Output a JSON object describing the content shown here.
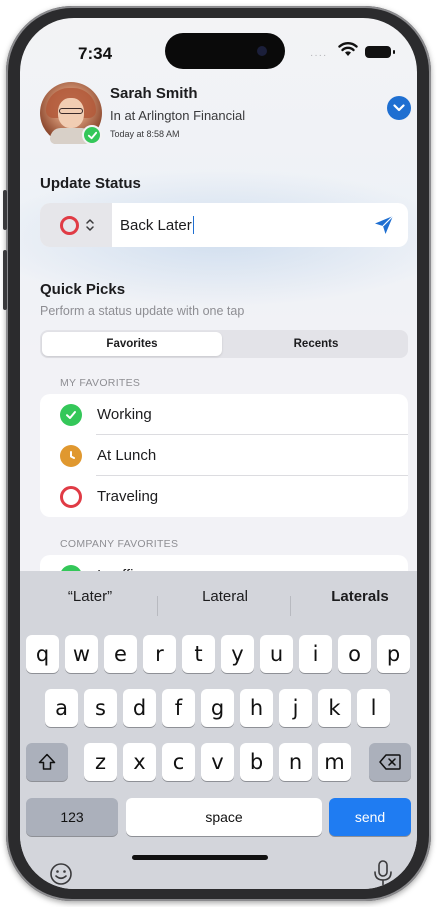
{
  "status_bar": {
    "time": "7:34",
    "signal_dots": "····"
  },
  "user": {
    "name": "Sarah Smith",
    "status": "In at Arlington Financial",
    "updated": "Today at 8:58 AM"
  },
  "update_status": {
    "title": "Update Status",
    "input_value": "Back Later"
  },
  "quick_picks": {
    "title": "Quick Picks",
    "subtitle": "Perform a status update with one tap",
    "tabs": [
      "Favorites",
      "Recents"
    ],
    "selected_tab": "Favorites",
    "my_favorites_header": "MY FAVORITES",
    "my_favorites": [
      {
        "label": "Working",
        "icon": "checkmark-icon",
        "color": "#34c759"
      },
      {
        "label": "At Lunch",
        "icon": "clock-icon",
        "color": "#e0982f"
      },
      {
        "label": "Traveling",
        "icon": "ring-icon",
        "color": "#e03b45"
      }
    ],
    "company_favorites_header": "COMPANY FAVORITES",
    "company_favorites": [
      {
        "label": "In office",
        "icon": "checkmark-icon",
        "color": "#34c759"
      }
    ]
  },
  "keyboard": {
    "suggestions": [
      "“Later”",
      "Lateral",
      "Laterals"
    ],
    "row1": [
      "q",
      "w",
      "e",
      "r",
      "t",
      "y",
      "u",
      "i",
      "o",
      "p"
    ],
    "row2": [
      "a",
      "s",
      "d",
      "f",
      "g",
      "h",
      "j",
      "k",
      "l"
    ],
    "row3": [
      "z",
      "x",
      "c",
      "v",
      "b",
      "n",
      "m"
    ],
    "numbers_label": "123",
    "space_label": "space",
    "send_label": "send"
  },
  "colors": {
    "accent": "#1f6fd1",
    "send_key": "#1f7cf2",
    "available": "#34c759",
    "busy": "#e03b45",
    "away": "#e0982f"
  }
}
